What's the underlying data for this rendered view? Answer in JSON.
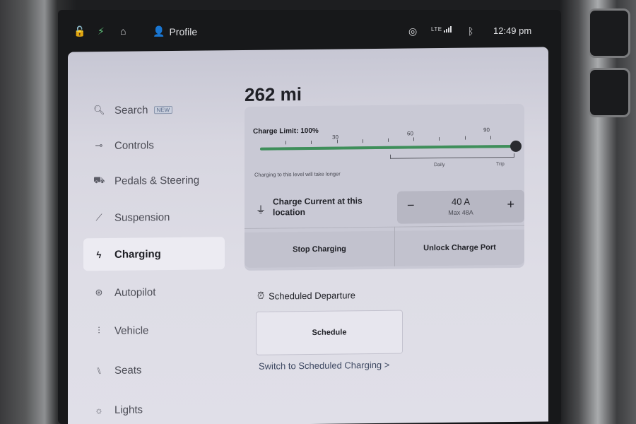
{
  "status_bar": {
    "profile_label": "Profile",
    "lte_label": "LTE",
    "time": "12:49 pm"
  },
  "sidebar": {
    "items": [
      {
        "label": "Search",
        "icon": "search-icon",
        "badge": "NEW"
      },
      {
        "label": "Controls",
        "icon": "toggle-icon"
      },
      {
        "label": "Pedals & Steering",
        "icon": "car-icon"
      },
      {
        "label": "Suspension",
        "icon": "wrench-icon"
      },
      {
        "label": "Charging",
        "icon": "bolt-icon",
        "active": true
      },
      {
        "label": "Autopilot",
        "icon": "steering-wheel-icon"
      },
      {
        "label": "Vehicle",
        "icon": "sliders-icon"
      },
      {
        "label": "Seats",
        "icon": "seat-icon"
      },
      {
        "label": "Lights",
        "icon": "light-icon"
      }
    ]
  },
  "charging": {
    "range": "262 mi",
    "limit_label": "Charge Limit: 100%",
    "limit_percent": 100,
    "tick_labels": [
      "30",
      "60",
      "90"
    ],
    "daily_label": "Daily",
    "trip_label": "Trip",
    "note": "Charging to this level will take longer",
    "current_label": "Charge Current at this location",
    "current_value": "40 A",
    "current_max": "Max 48A",
    "minus_label": "−",
    "plus_label": "+",
    "stop_label": "Stop Charging",
    "unlock_label": "Unlock Charge Port"
  },
  "scheduled": {
    "title": "Scheduled Departure",
    "schedule_label": "Schedule",
    "switch_link": "Switch to Scheduled Charging >"
  },
  "colors": {
    "accent_green": "#3e8f5a",
    "panel_bg": "#dedde6",
    "text_dark": "#1f2026"
  }
}
